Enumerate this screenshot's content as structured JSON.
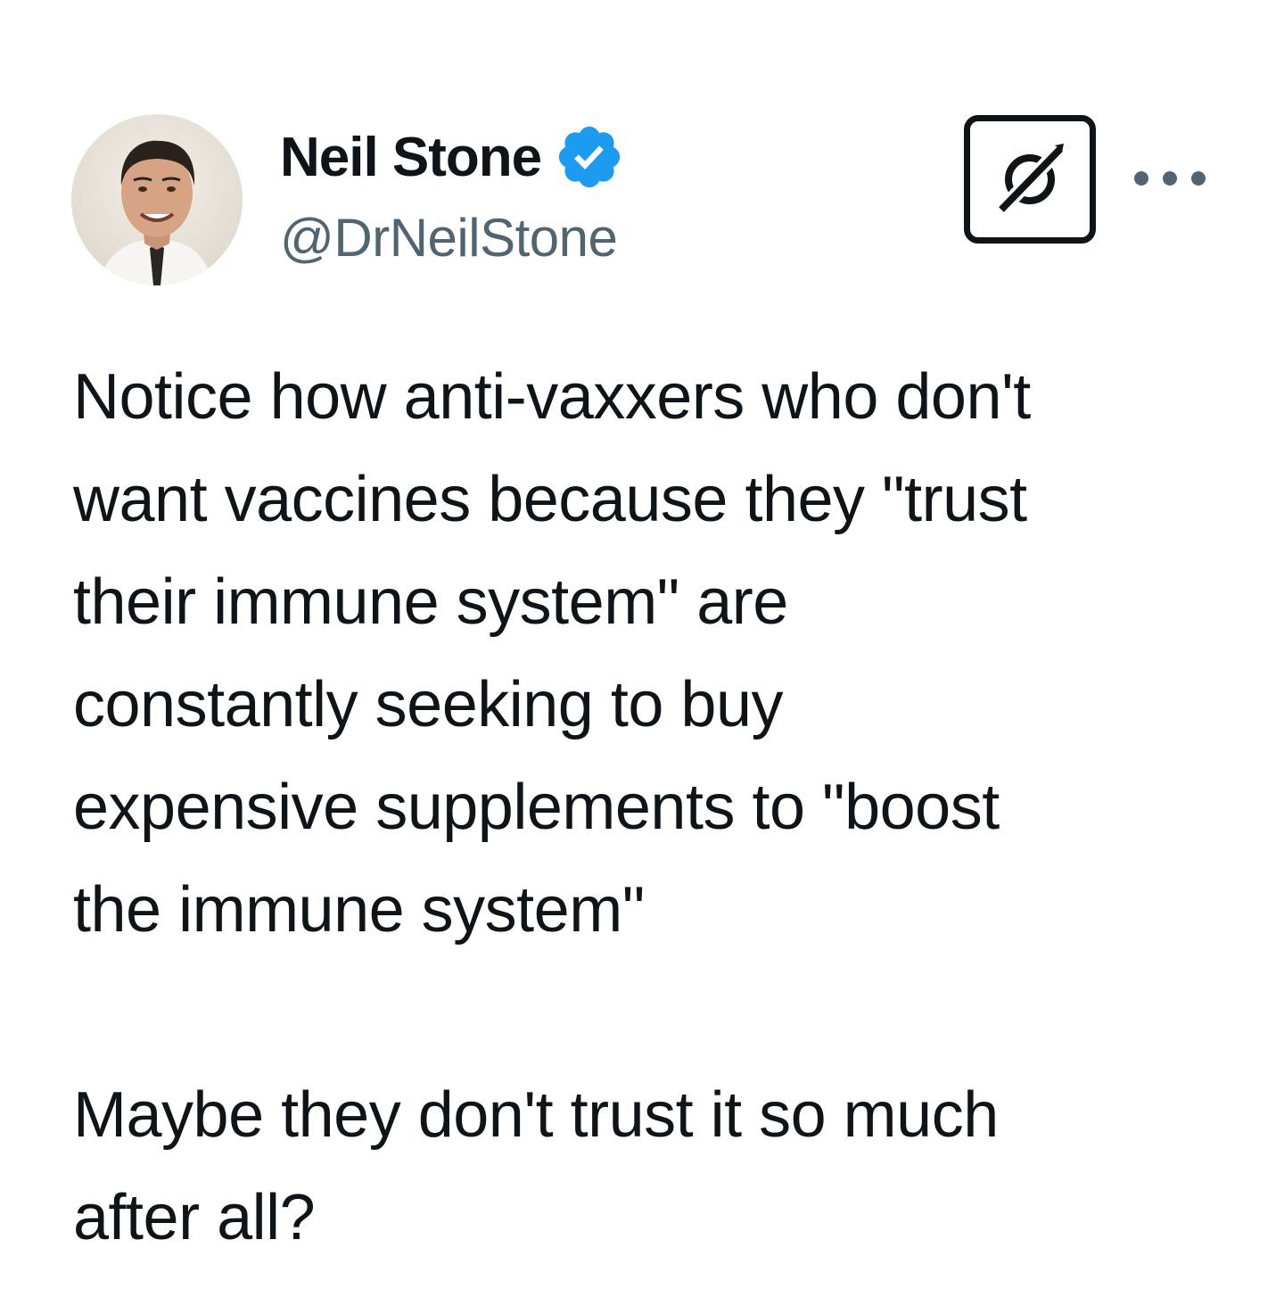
{
  "author": {
    "display_name": "Neil Stone",
    "handle": "@DrNeilStone",
    "verified": true,
    "verified_color": "#1d9bf0"
  },
  "header": {
    "grok_icon": "grok-icon",
    "more_icon": "more-options-icon"
  },
  "tweet": {
    "paragraphs": [
      "Notice how anti-vaxxers who don't\nwant vaccines because they \"trust\ntheir immune system\" are\nconstantly seeking to buy\nexpensive supplements to \"boost\nthe immune system\"",
      "Maybe they don't trust it so much\nafter all?"
    ]
  },
  "colors": {
    "text_primary": "#0f1419",
    "text_secondary": "#536471",
    "background": "#ffffff"
  }
}
